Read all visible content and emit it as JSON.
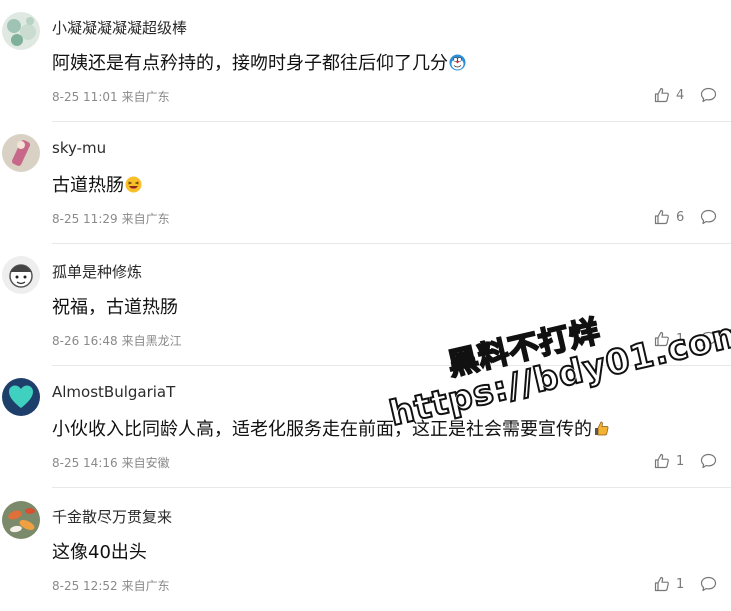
{
  "comments": [
    {
      "username": "小凝凝凝凝凝超级棒",
      "content": "阿姨还是有点矜持的，接吻时身子都往后仰了几分",
      "emoji": "doraemon-emoji",
      "date": "8-25 11:01",
      "location": "来自广东",
      "likes": "4",
      "avatar": "flower-avatar"
    },
    {
      "username": "sky-mu",
      "content": "古道热肠",
      "emoji": "laughing-emoji",
      "date": "8-25 11:29",
      "location": "来自广东",
      "likes": "6",
      "avatar": "figure-avatar"
    },
    {
      "username": "孤单是种修炼",
      "content": "祝福，古道热肠",
      "emoji": "",
      "date": "8-26 16:48",
      "location": "来自黑龙江",
      "likes": "1",
      "avatar": "cartoon-avatar"
    },
    {
      "username": "AlmostBulgariaT",
      "content": "小伙收入比同龄人高，适老化服务走在前面，这正是社会需要宣传的",
      "emoji": "thumbs-up-emoji",
      "date": "8-25 14:16",
      "location": "来自安徽",
      "likes": "1",
      "avatar": "heart-avatar"
    },
    {
      "username": "千金散尽万贯复来",
      "content": "这像40出头",
      "emoji": "",
      "date": "8-25 12:52",
      "location": "来自广东",
      "likes": "1",
      "avatar": "koi-avatar"
    }
  ],
  "watermark": {
    "line1": "黑料不打烊",
    "line2": "https://bdy01.com"
  },
  "colors": {
    "text": "#111111",
    "meta": "#8a8a8a",
    "divider": "#e8e8e8"
  }
}
